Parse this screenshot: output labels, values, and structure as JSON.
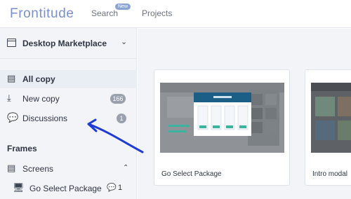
{
  "app": {
    "logo": "Frontitude"
  },
  "nav": {
    "search": "Search",
    "new_badge": "New",
    "projects": "Projects"
  },
  "sidebar": {
    "project_name": "Desktop Marketplace",
    "items": [
      {
        "label": "All copy",
        "count": ""
      },
      {
        "label": "New copy",
        "count": "166"
      },
      {
        "label": "Discussions",
        "count": "1"
      }
    ],
    "frames_heading": "Frames",
    "screens_label": "Screens",
    "screen_item": {
      "label": "Go Select Package",
      "comment_count": "1"
    }
  },
  "cards": [
    {
      "title": "Go Select Package"
    },
    {
      "title": "Intro modal"
    }
  ],
  "colors": {
    "accent": "#7a8fd0",
    "arrow": "#1f3bd6",
    "badge": "#9aa1ae"
  }
}
